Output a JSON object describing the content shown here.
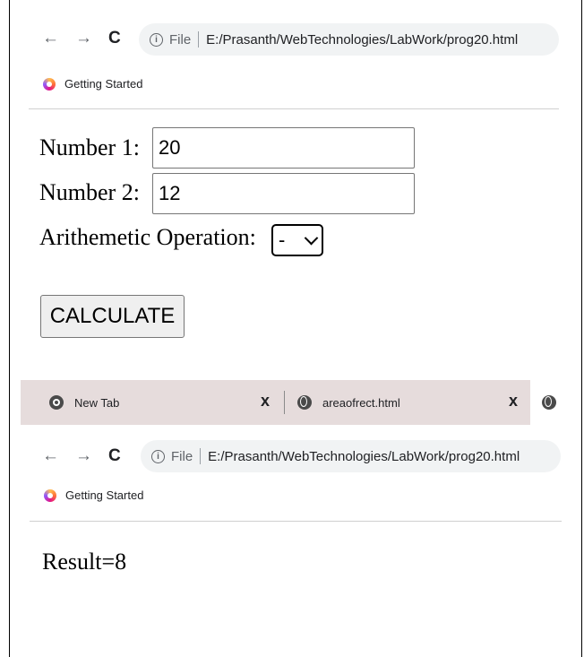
{
  "browser": {
    "url_scheme": "File",
    "url_path": "E:/Prasanth/WebTechnologies/LabWork/prog20.html",
    "back_icon": "←",
    "forward_icon": "→",
    "reload_icon": "C",
    "info_icon": "i",
    "bookmark": "Getting Started"
  },
  "form": {
    "number1_label": "Number 1:",
    "number1_value": "20",
    "number2_label": "Number 2:",
    "number2_value": "12",
    "operation_label": "Arithemetic Operation:",
    "operation_selected": "-",
    "calculate_label": "CALCULATE"
  },
  "tabs": [
    {
      "title": "New Tab",
      "icon": "chrome-icon",
      "close": "x"
    },
    {
      "title": "areaofrect.html",
      "icon": "globe-icon",
      "close": "x"
    }
  ],
  "result": {
    "text": "Result=8"
  }
}
